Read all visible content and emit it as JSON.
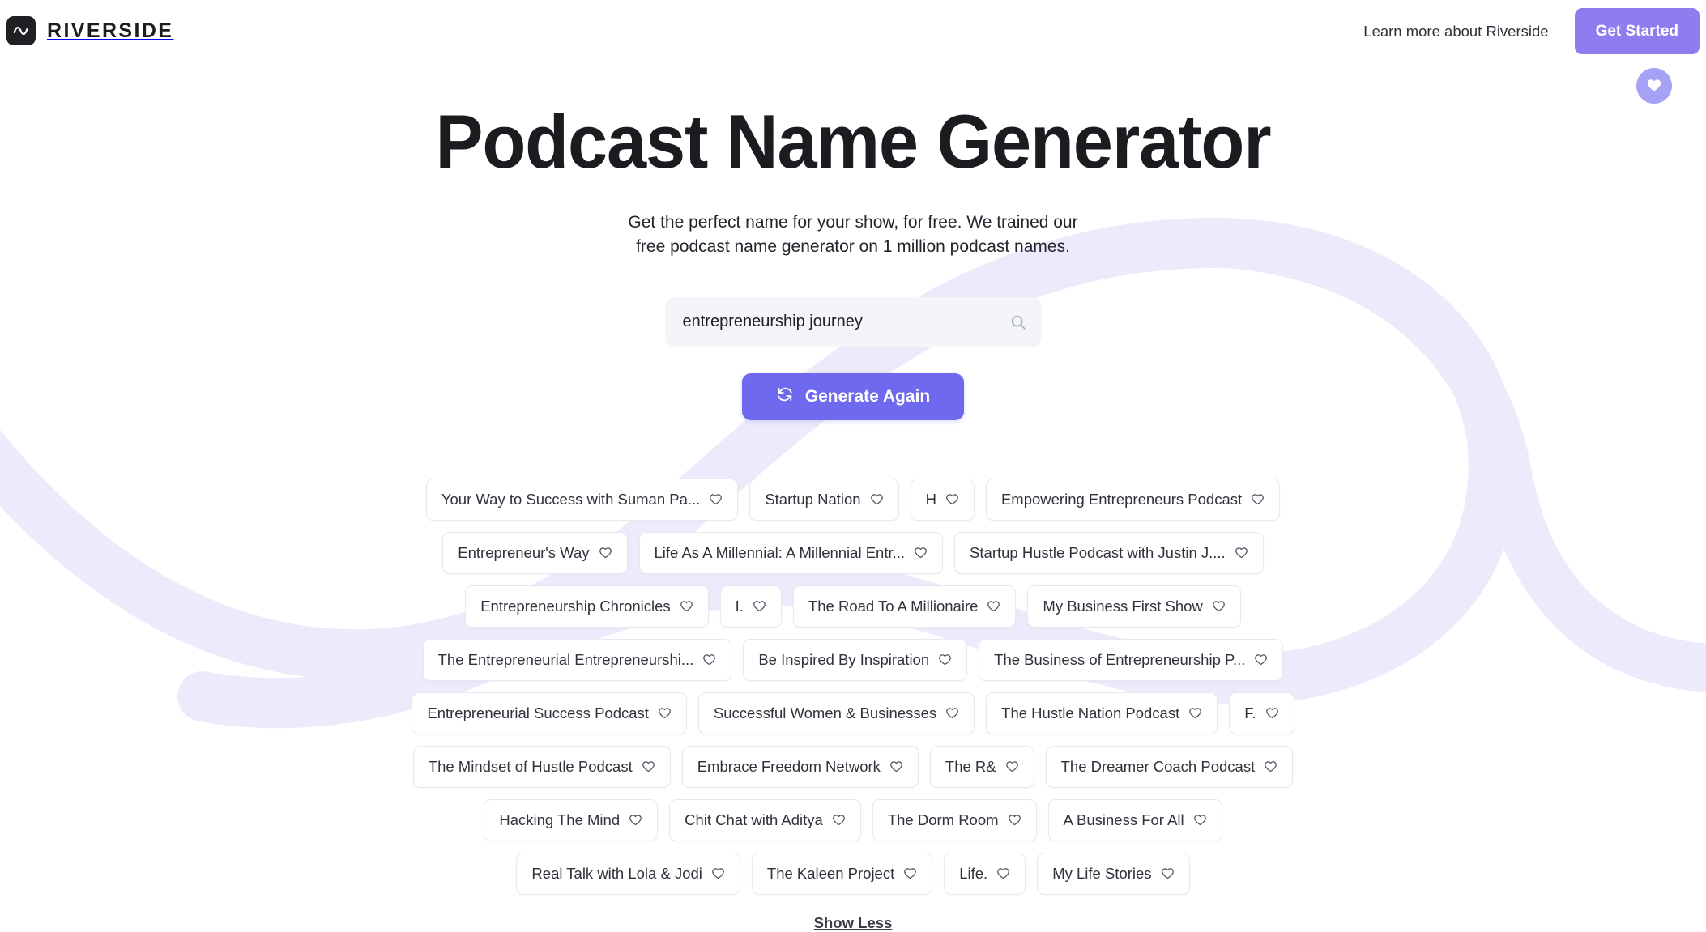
{
  "header": {
    "brand_name": "RIVERSIDE",
    "brand_icon": "waveform-icon",
    "learn_more_label": "Learn more about Riverside",
    "get_started_label": "Get Started",
    "favorites_fab_icon": "heart-filled-icon"
  },
  "hero": {
    "title": "Podcast Name Generator",
    "subtitle": "Get the perfect name for your show, for free. We trained our\nfree podcast name generator on 1 million podcast names."
  },
  "search": {
    "value": "entrepreneurship journey",
    "placeholder": "Enter a keyword",
    "icon": "search-icon"
  },
  "generate": {
    "label": "Generate Again",
    "icon": "refresh-icon"
  },
  "results": {
    "heart_icon": "heart-outline-icon",
    "rows": [
      [
        "Your Way to Success with Suman Pa...",
        "Startup Nation",
        "H",
        "Empowering Entrepreneurs Podcast"
      ],
      [
        "Entrepreneur's Way",
        "Life As A Millennial: A Millennial Entr...",
        "Startup Hustle Podcast with Justin J...."
      ],
      [
        "Entrepreneurship Chronicles",
        "I.",
        "The Road To A Millionaire",
        "My Business First Show"
      ],
      [
        "The Entrepreneurial Entrepreneurshi...",
        "Be Inspired By Inspiration",
        "The Business of Entrepreneurship P..."
      ],
      [
        "Entrepreneurial Success Podcast",
        "Successful Women & Businesses",
        "The Hustle Nation Podcast",
        "F."
      ],
      [
        "The Mindset of Hustle Podcast",
        "Embrace Freedom Network",
        "The R&",
        "The Dreamer Coach Podcast"
      ],
      [
        "Hacking The Mind",
        "Chit Chat with Aditya",
        "The Dorm Room",
        "A Business For All"
      ],
      [
        "Real Talk with Lola & Jodi",
        "The Kaleen Project",
        "Life.",
        "My Life Stories"
      ]
    ]
  },
  "footer": {
    "show_less_label": "Show Less"
  },
  "colors": {
    "accent_purple": "#6f69ef",
    "button_purple": "#8f7df0",
    "fab_purple": "#a5a2f5",
    "swirl_lavender": "#ecebfb",
    "text_dark": "#1b1c20",
    "chip_border": "#e8e9ef",
    "search_bg": "#f4f5f9"
  }
}
